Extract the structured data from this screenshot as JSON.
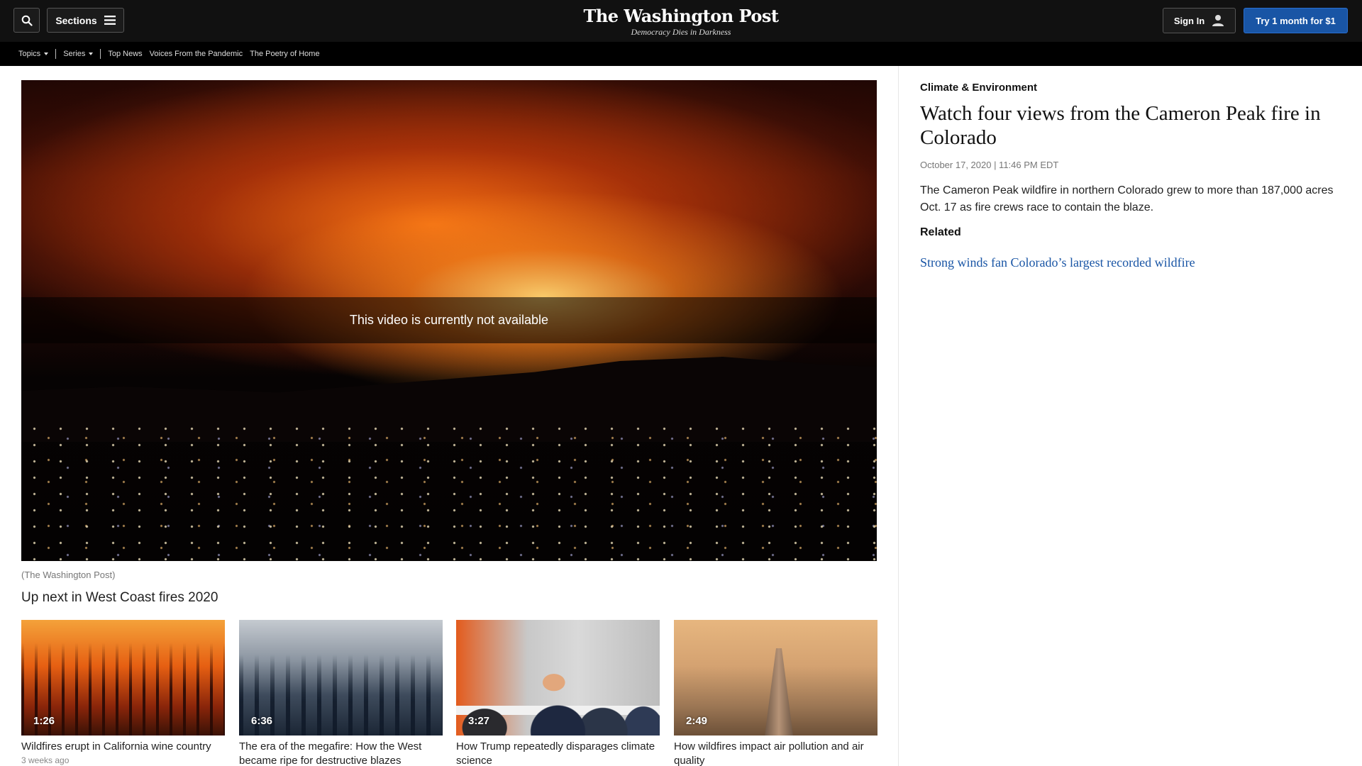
{
  "header": {
    "sections_label": "Sections",
    "logo": "The Washington Post",
    "tagline": "Democracy Dies in Darkness",
    "signin_label": "Sign In",
    "try_label": "Try 1 month for $1"
  },
  "subnav": {
    "topics": "Topics",
    "series": "Series",
    "items": [
      "Top News",
      "Voices From the Pandemic",
      "The Poetry of Home"
    ]
  },
  "video": {
    "overlay_text": "This video is currently not available",
    "credit": "(The Washington Post)"
  },
  "upnext": {
    "heading": "Up next in West Coast fires 2020",
    "cards": [
      {
        "duration": "1:26",
        "title": "Wildfires erupt in California wine country",
        "time": "3 weeks ago"
      },
      {
        "duration": "6:36",
        "title": "The era of the megafire: How the West became ripe for destructive blazes"
      },
      {
        "duration": "3:27",
        "title": "How Trump repeatedly disparages climate science"
      },
      {
        "duration": "2:49",
        "title": "How wildfires impact air pollution and air quality"
      }
    ]
  },
  "article": {
    "kicker": "Climate & Environment",
    "headline": "Watch four views from the Cameron Peak fire in Colorado",
    "dateline": "October 17, 2020 | 11:46 PM EDT",
    "blurb": "The Cameron Peak wildfire in northern Colorado grew to more than 187,000 acres Oct. 17 as fire crews race to contain the blaze.",
    "related_heading": "Related",
    "related_link": "Strong winds fan Colorado’s largest recorded wildfire"
  },
  "icons": {
    "search": "search-icon",
    "menu": "hamburger-icon",
    "user": "user-icon",
    "caret": "caret-down-icon"
  },
  "colors": {
    "header_bg": "#111111",
    "accent_blue": "#1955a5"
  }
}
